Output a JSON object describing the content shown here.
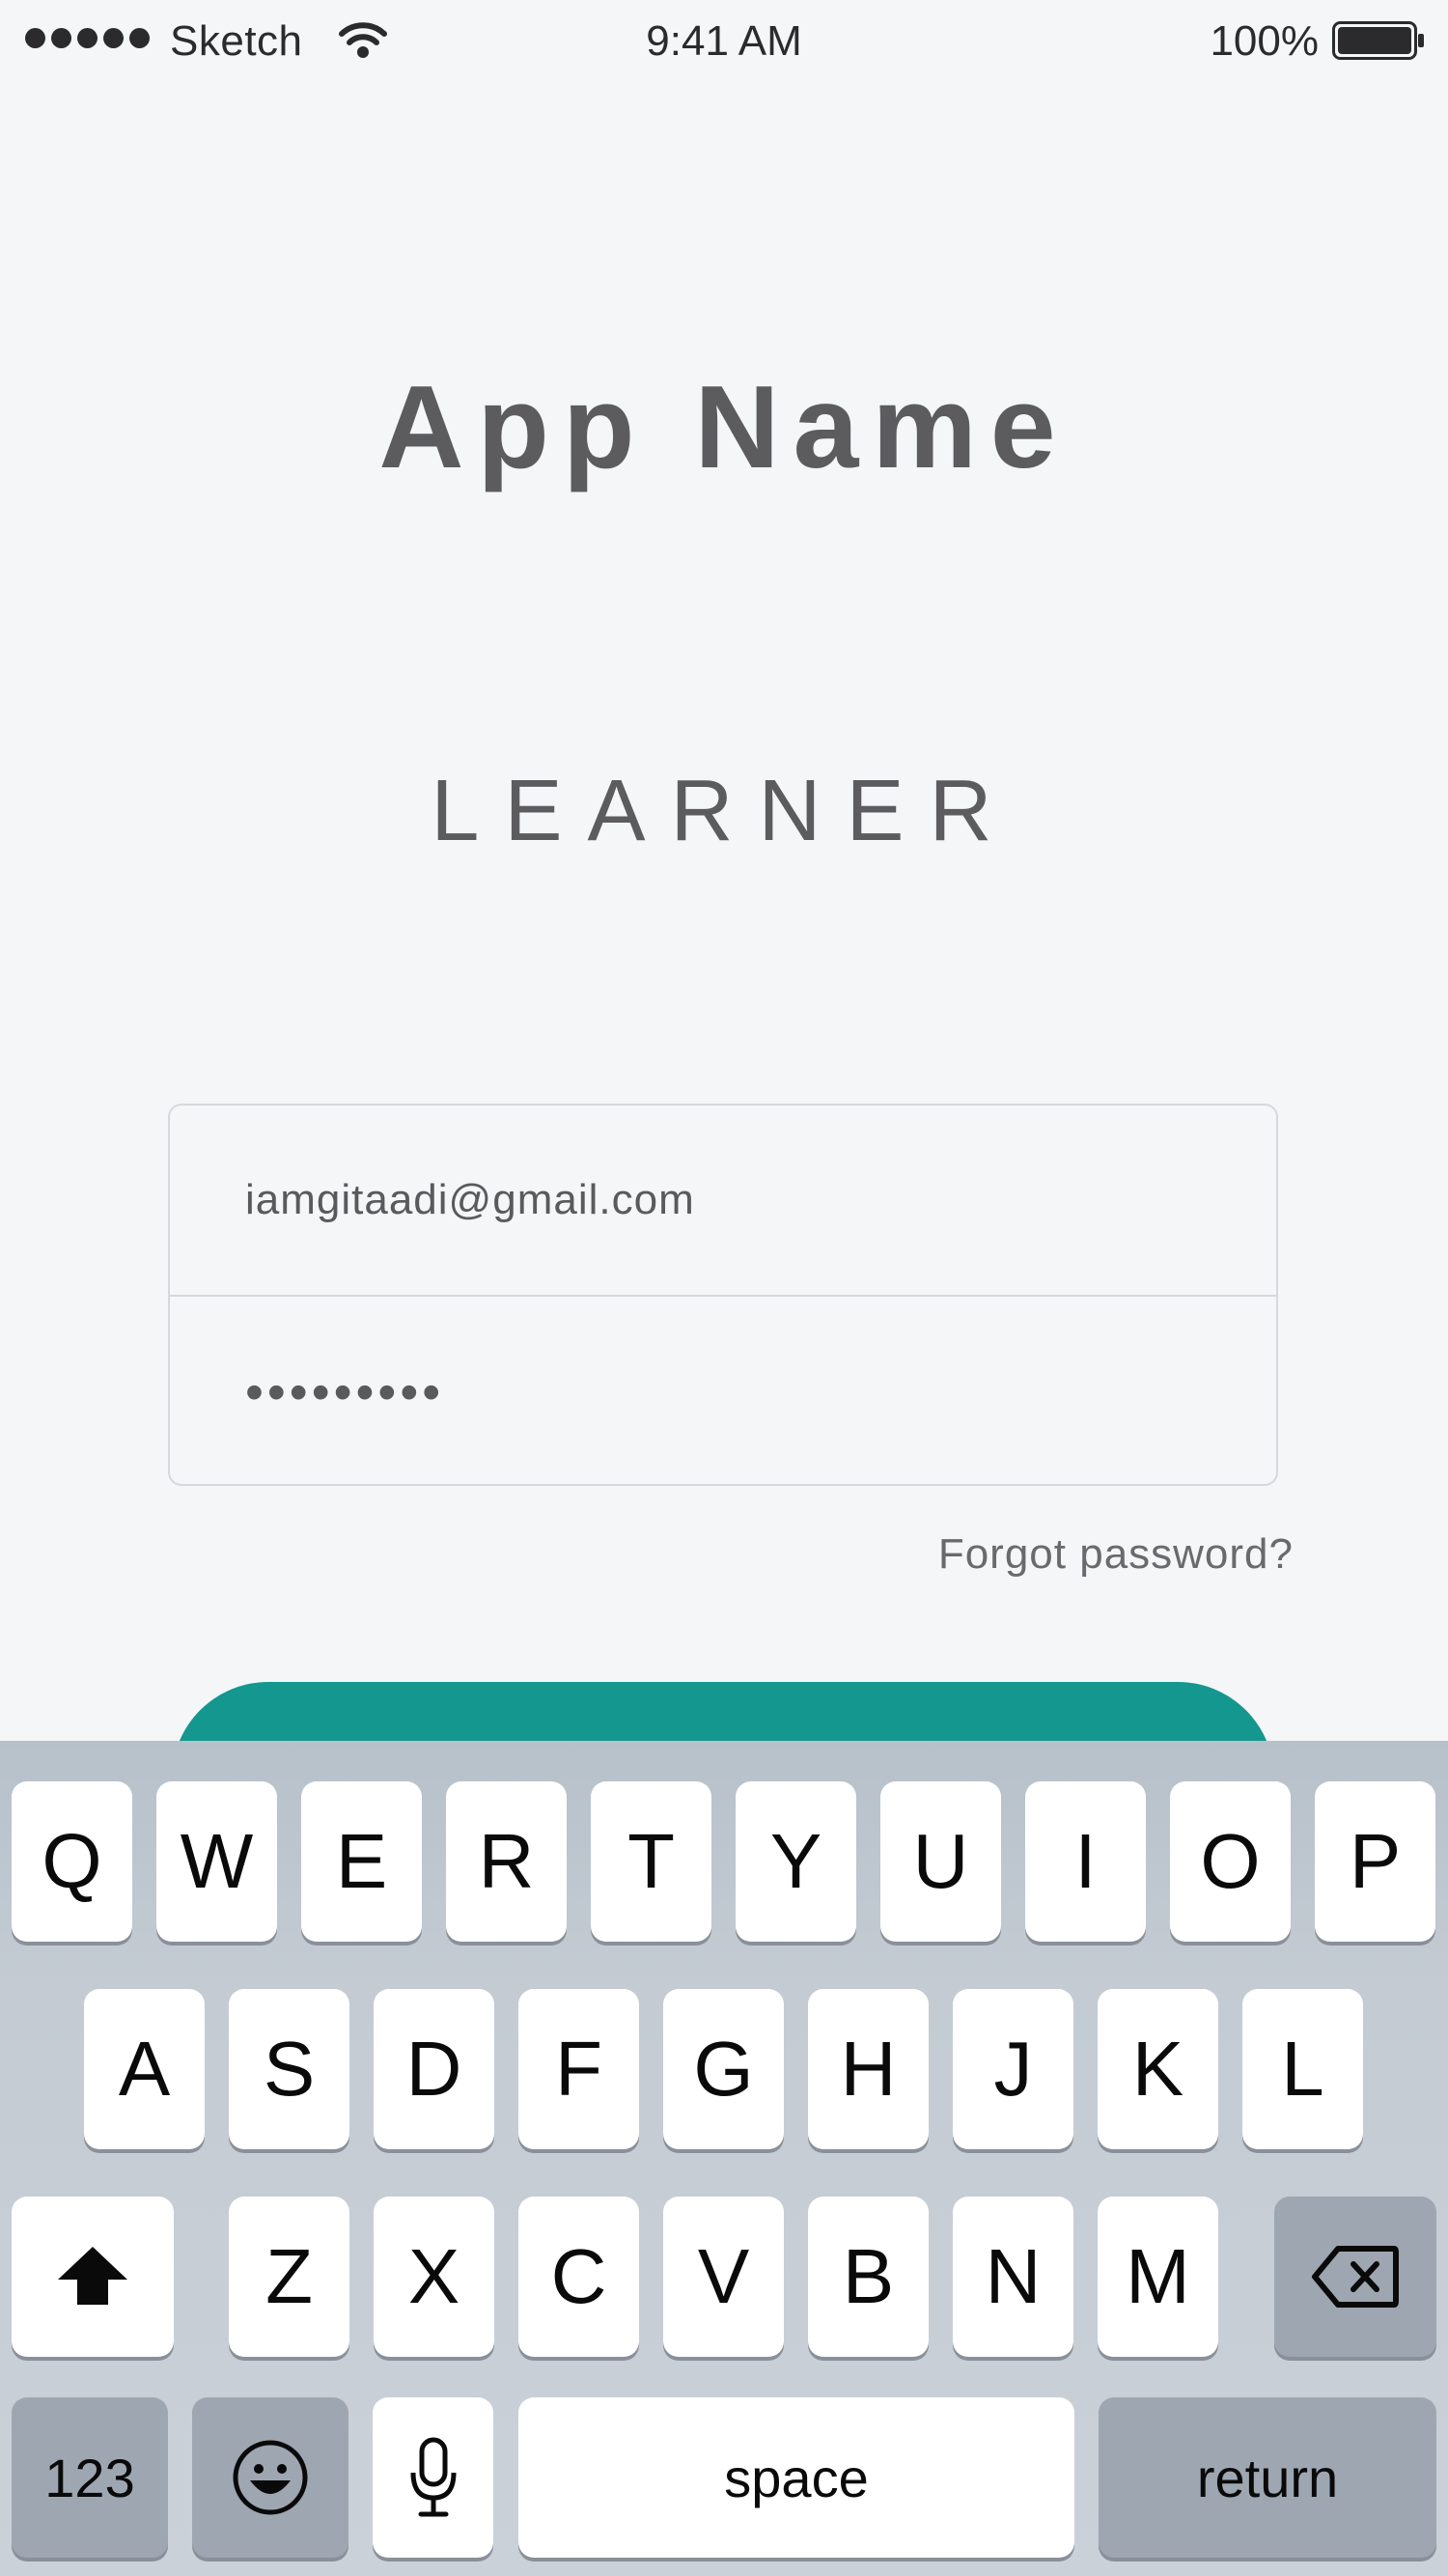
{
  "status_bar": {
    "carrier": "Sketch",
    "time": "9:41 AM",
    "battery_percent": "100%",
    "signal_icon": "signal-dots-icon",
    "wifi_icon": "wifi-icon",
    "battery_icon": "battery-icon"
  },
  "header": {
    "app_name": "App Name",
    "role": "LEARNER"
  },
  "login_form": {
    "email_value": "iamgitaadi@gmail.com",
    "password_value": "•••••••••",
    "forgot_password_label": "Forgot password?"
  },
  "colors": {
    "background": "#f4f6f8",
    "accent": "#13978f",
    "text": "#5c5c5f"
  },
  "keyboard": {
    "row1": [
      "Q",
      "W",
      "E",
      "R",
      "T",
      "Y",
      "U",
      "I",
      "O",
      "P"
    ],
    "row2": [
      "A",
      "S",
      "D",
      "F",
      "G",
      "H",
      "J",
      "K",
      "L"
    ],
    "row3": [
      "Z",
      "X",
      "C",
      "V",
      "B",
      "N",
      "M"
    ],
    "numbers_label": "123",
    "space_label": "space",
    "return_label": "return",
    "shift_icon": "shift-icon",
    "delete_icon": "delete-icon",
    "emoji_icon": "emoji-icon",
    "mic_icon": "microphone-icon"
  }
}
